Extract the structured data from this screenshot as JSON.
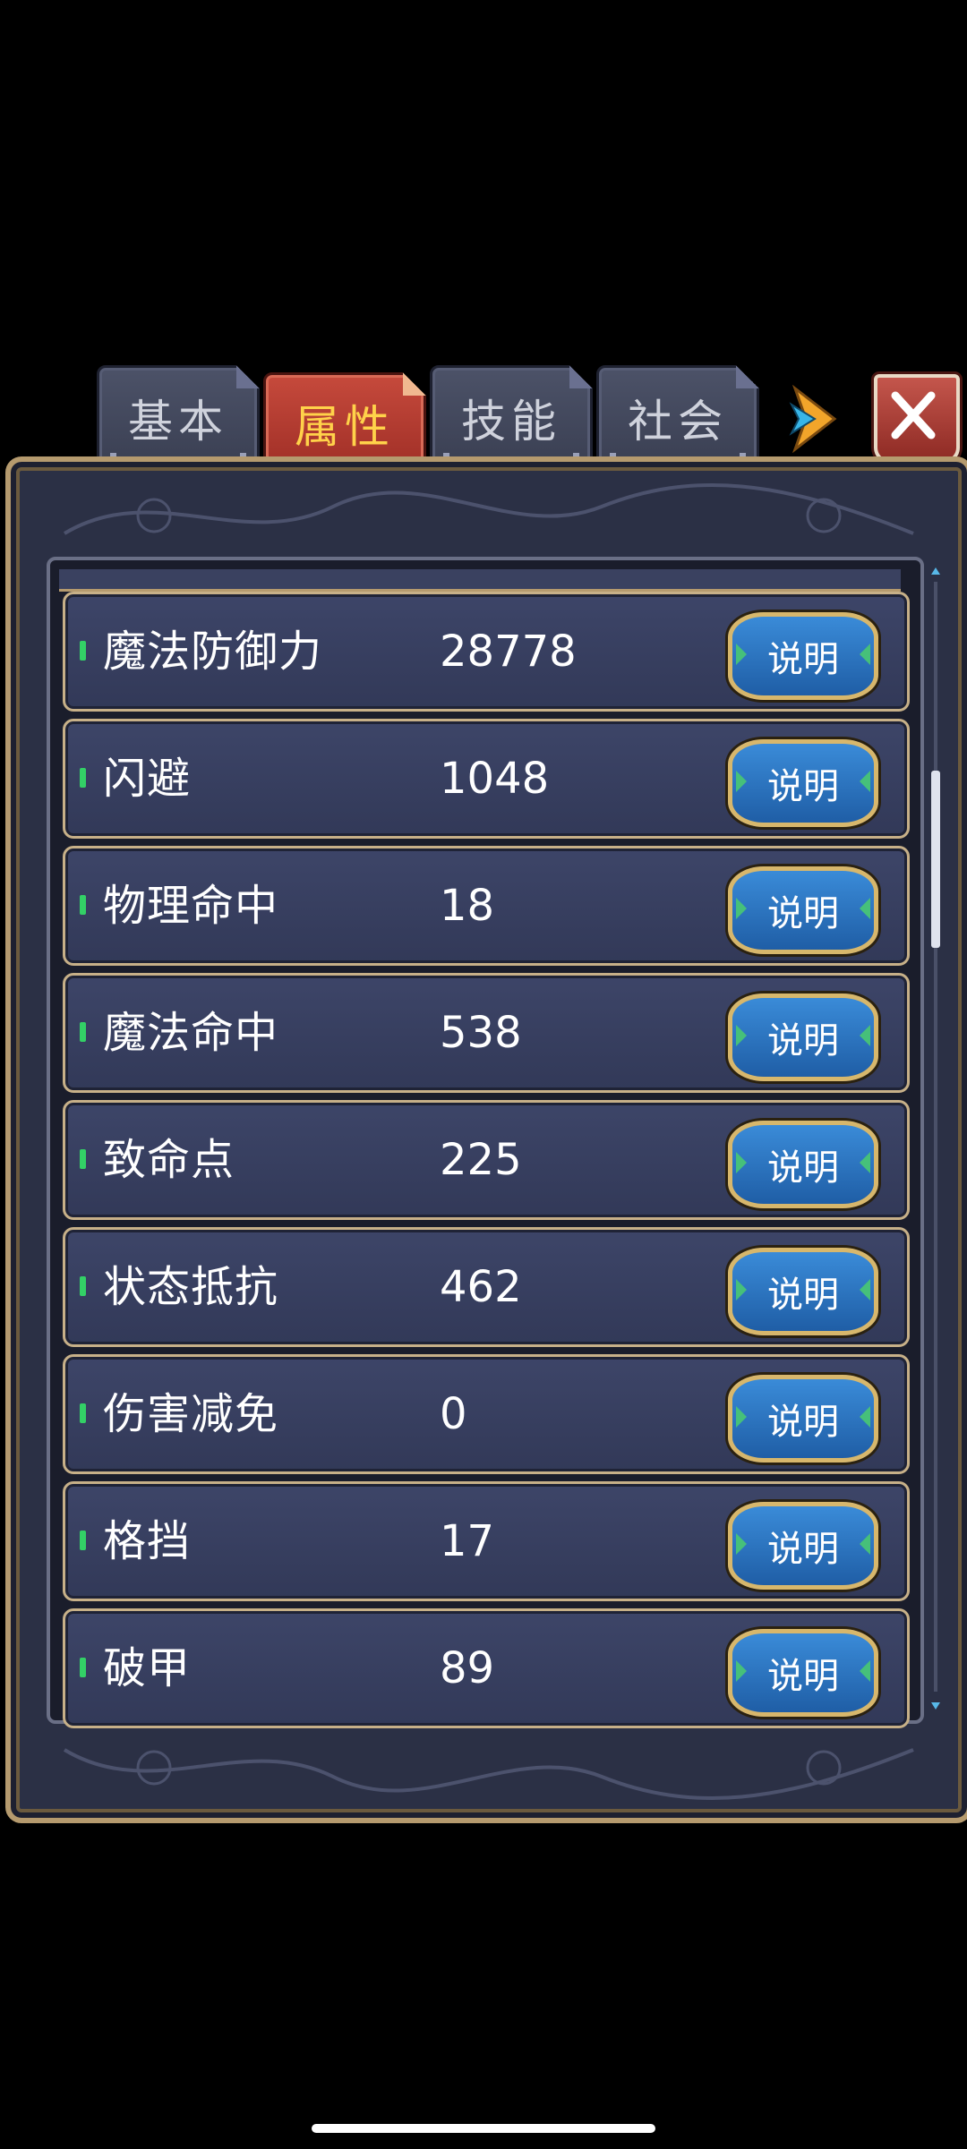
{
  "tabs": [
    {
      "label": "基本",
      "active": false
    },
    {
      "label": "属性",
      "active": true
    },
    {
      "label": "技能",
      "active": false
    },
    {
      "label": "社会",
      "active": false
    }
  ],
  "colors": {
    "active_tab_text": "#ffd24a",
    "inactive_tab_text": "#cfd2dc",
    "marker": "#33d066",
    "panel_gold": "#b59a6e",
    "info_button": "#1f5ea6"
  },
  "icons": {
    "next": "arrow-right-icon",
    "close": "close-icon"
  },
  "attributes": [
    {
      "name": "魔法防御力",
      "value": "28778",
      "button": "说明"
    },
    {
      "name": "闪避",
      "value": "1048",
      "button": "说明"
    },
    {
      "name": "物理命中",
      "value": "18",
      "button": "说明"
    },
    {
      "name": "魔法命中",
      "value": "538",
      "button": "说明"
    },
    {
      "name": "致命点",
      "value": "225",
      "button": "说明"
    },
    {
      "name": "状态抵抗",
      "value": "462",
      "button": "说明"
    },
    {
      "name": "伤害减免",
      "value": "0",
      "button": "说明"
    },
    {
      "name": "格挡",
      "value": "17",
      "button": "说明"
    },
    {
      "name": "破甲",
      "value": "89",
      "button": "说明"
    }
  ],
  "scroll": {
    "position_fraction": 0.17,
    "visible_fraction": 0.16
  }
}
